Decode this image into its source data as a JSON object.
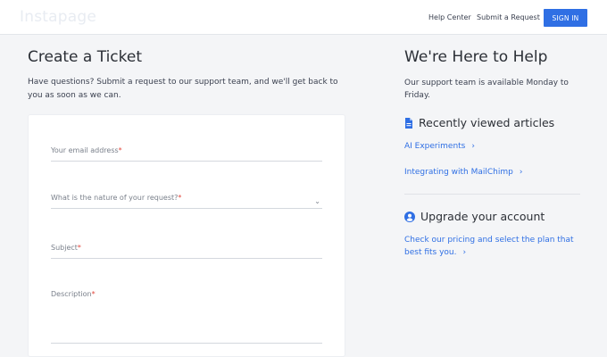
{
  "header": {
    "logo": "Instapage",
    "nav": [
      "Help Center",
      "Submit a Request"
    ],
    "signin_label": "SIGN IN"
  },
  "main": {
    "title": "Create a Ticket",
    "intro": "Have questions? Submit a request to our support team, and we'll get back to you as soon as we can.",
    "fields": [
      {
        "label": "Your email address",
        "required": "*"
      },
      {
        "label": "What is the nature of your request?",
        "required": "*"
      },
      {
        "label": "Subject",
        "required": "*"
      },
      {
        "label": "Description",
        "required": "*"
      }
    ]
  },
  "sidebar": {
    "title": "We're Here to Help",
    "availability": "Our support team is available Monday to Friday.",
    "recent_title": "Recently viewed articles",
    "articles": [
      "AI Experiments",
      "Integrating with MailChimp"
    ],
    "upgrade_title": "Upgrade your account",
    "upgrade_link": "Check our pricing and select the plan that best fits you."
  },
  "colors": {
    "accent": "#2f6fe4",
    "required": "#e2483d"
  },
  "icons": {
    "article": "document-icon",
    "account": "user-circle-icon",
    "link": "chevron-right-icon",
    "select": "chevron-down-icon"
  }
}
